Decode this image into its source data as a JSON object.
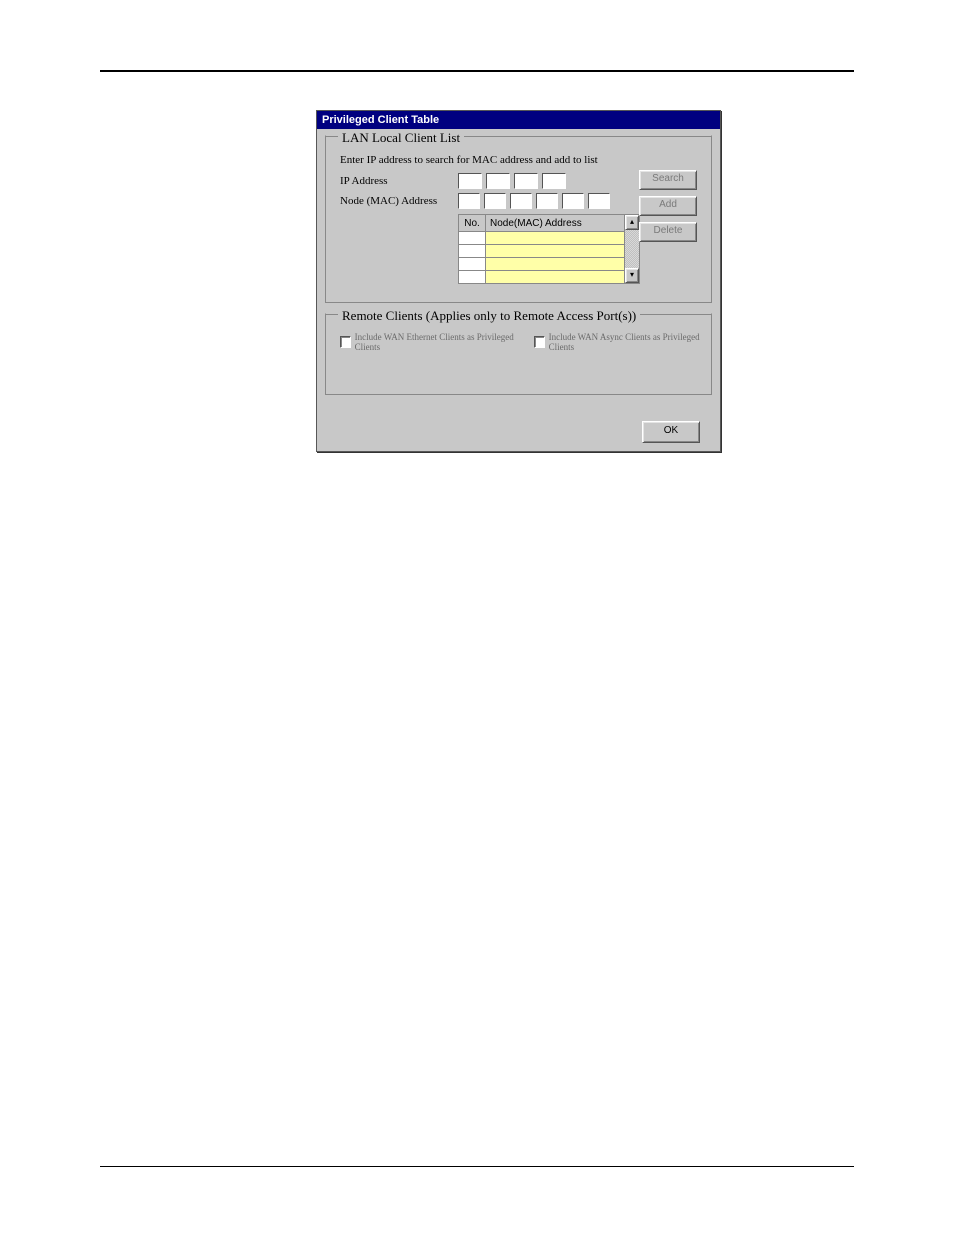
{
  "dialog": {
    "title": "Privileged Client Table",
    "lan": {
      "legend": "LAN Local Client List",
      "instruction": "Enter IP address to search for MAC address and add to list",
      "ip_label": "IP Address",
      "mac_label": "Node (MAC) Address",
      "table": {
        "col_no": "No.",
        "col_addr": "Node(MAC) Address"
      }
    },
    "remote": {
      "legend": "Remote Clients (Applies only to Remote Access Port(s))",
      "chk1": "Include WAN Ethernet Clients as Privileged Clients",
      "chk2": "Include WAN Async Clients as Privileged Clients"
    },
    "buttons": {
      "search": "Search",
      "add": "Add",
      "delete": "Delete",
      "ok": "OK"
    }
  }
}
